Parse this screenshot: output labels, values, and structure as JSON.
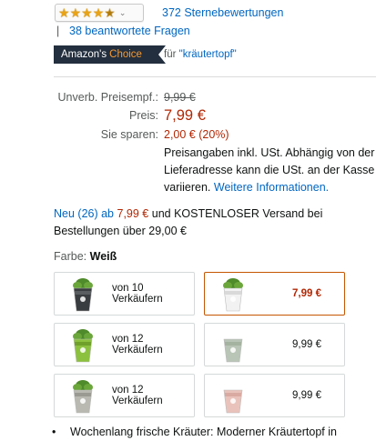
{
  "rating": {
    "stars_value": 4.5,
    "count_text": "372 Sternebewertungen",
    "questions_separator": "|",
    "questions_text": "38 beantwortete Fragen"
  },
  "choice": {
    "badge_word1": "Amazon's",
    "badge_word2": "Choice",
    "for_text": "für",
    "query": "\"kräutertopf\""
  },
  "prices": {
    "list_label": "Unverb. Preisempf.:",
    "list_value": "9,99 €",
    "price_label": "Preis:",
    "price_value": "7,99 €",
    "save_label": "Sie sparen:",
    "save_value": "2,00 € (20%)",
    "tax_note": "Preisangaben inkl. USt. Abhängig von der Lieferadresse kann die USt. an der Kasse variieren.",
    "tax_link": "Weitere Informationen."
  },
  "offers": {
    "new_link": "Neu (26) ab",
    "new_price": "7,99 €",
    "shipping_text": "und KOSTENLOSER Versand bei Bestellungen über 29,00 €"
  },
  "color": {
    "label": "Farbe:",
    "selected": "Weiß"
  },
  "swatches": [
    {
      "text": "von 10 Verkäufern",
      "price": "",
      "selected": false,
      "pot_color": "#3a3d3f",
      "band": "#5a5d60"
    },
    {
      "text": "",
      "price": "7,99 €",
      "selected": true,
      "pot_color": "#f2f2f2",
      "band": "#d9d9d9"
    },
    {
      "text": "von 12 Verkäufern",
      "price": "",
      "selected": false,
      "pot_color": "#8cc13f",
      "band": "#6fa02a"
    },
    {
      "text": "",
      "price": "9,99 €",
      "selected": false,
      "pot_color": "#b9c5b6",
      "band": "#a4b2a0"
    },
    {
      "text": "von 12 Verkäufern",
      "price": "",
      "selected": false,
      "pot_color": "#b9b9b2",
      "band": "#9a9a93"
    },
    {
      "text": "",
      "price": "9,99 €",
      "selected": false,
      "pot_color": "#e9c3bb",
      "band": "#d9aaa1"
    }
  ],
  "bullet_text": "Wochenlang frische Kräuter: Moderner Kräutertopf in"
}
